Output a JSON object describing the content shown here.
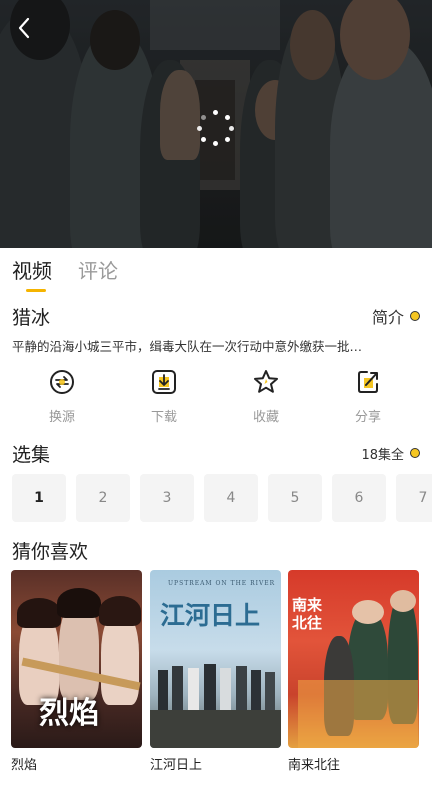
{
  "player": {
    "back_icon": "chevron-left-icon",
    "loading_icon": "loading-spinner-icon"
  },
  "tabs": [
    {
      "label": "视频",
      "active": true
    },
    {
      "label": "评论",
      "active": false
    }
  ],
  "show": {
    "title": "猎冰",
    "intro_label": "简介",
    "description": "平静的沿海小城三平市，缉毒大队在一次行动中意外缴获一批…"
  },
  "actions": [
    {
      "label": "换源",
      "icon": "switch-source-icon"
    },
    {
      "label": "下载",
      "icon": "download-icon"
    },
    {
      "label": "收藏",
      "icon": "star-icon"
    },
    {
      "label": "分享",
      "icon": "share-icon"
    }
  ],
  "episodes": {
    "title": "选集",
    "count_label": "18集全",
    "items": [
      "1",
      "2",
      "3",
      "4",
      "5",
      "6",
      "7"
    ],
    "selected": "1"
  },
  "recommendations": {
    "title": "猜你喜欢",
    "items": [
      {
        "name": "烈焰",
        "poster_text": "烈焰"
      },
      {
        "name": "江河日上",
        "poster_text": "江河日上",
        "poster_caption": "UPSTREAM ON THE RIVER"
      },
      {
        "name": "南来北往",
        "poster_text": "南来北往"
      }
    ]
  },
  "colors": {
    "accent": "#f5b400",
    "tab_inactive": "#9a9a9a",
    "episode_bg": "#f4f4f4",
    "action_label": "#999999"
  }
}
